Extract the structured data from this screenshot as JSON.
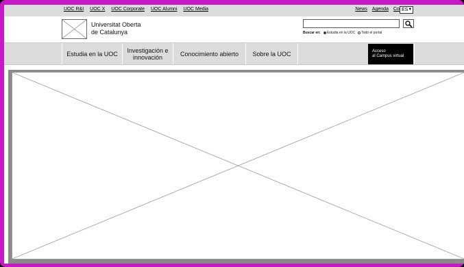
{
  "utility": {
    "links": [
      "UOC R&I",
      "UOC X",
      "UOC Corporate",
      "UOC Alumni",
      "UOC Media"
    ],
    "right_links": [
      "News",
      "Agenda",
      "Contacto"
    ],
    "language": "ES"
  },
  "brand": {
    "line1": "Universitat Oberta",
    "line2": "de Catalunya",
    "logo_icon": "image-placeholder-icon"
  },
  "search": {
    "value": "",
    "button_icon": "search-icon",
    "scope_label": "Buscar en:",
    "options": [
      "Estudia en la UOC",
      "Todo el portal"
    ],
    "selected": "Estudia en la UOC"
  },
  "nav": {
    "items": [
      "Estudia en la UOC",
      "Investigación e innovación",
      "Conocimiento abierto",
      "Sobre la UOC"
    ],
    "campus_line1": "Acceso",
    "campus_line2": "al Campus virtual"
  },
  "hero": {
    "icon": "image-placeholder-icon"
  },
  "colors": {
    "frame": "#c71ac7",
    "bar": "#dcdcdc",
    "campus_button": "#000000"
  }
}
